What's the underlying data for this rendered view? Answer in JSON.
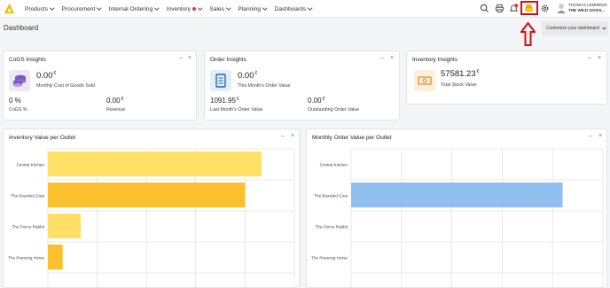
{
  "nav": {
    "items": [
      {
        "label": "Products"
      },
      {
        "label": "Procurement"
      },
      {
        "label": "Internal Ordering"
      },
      {
        "label": "Inventory"
      },
      {
        "label": "Sales"
      },
      {
        "label": "Planning"
      },
      {
        "label": "Dashboards"
      }
    ]
  },
  "user": {
    "name": "THOMAS LEMMENS",
    "company": "THE WILD GOOS..."
  },
  "notification_count": "",
  "page": {
    "title": "Dashboard",
    "customize_label": "Customize your dashboard"
  },
  "colors": {
    "accent": "#f5b800",
    "highlight": "#e30613",
    "bar_yellow": "#fbc02d",
    "bar_light_yellow": "#ffe066",
    "bar_blue": "#90bff0"
  },
  "cogs": {
    "title": "CoGS Insights",
    "value": "0.00",
    "currency": "€",
    "value_label": "Monthly Cost of Goods Sold",
    "pct": "0 %",
    "pct_label": "CoGS %",
    "revenue": "0.00",
    "revenue_currency": "€",
    "revenue_label": "Revenue"
  },
  "order": {
    "title": "Order Insights",
    "value": "0.00",
    "currency": "€",
    "value_label": "This Month's Order Value",
    "last": "1091.95",
    "last_currency": "€",
    "last_label": "Last Month's Order Value",
    "outstanding": "0.00",
    "outstanding_currency": "€",
    "outstanding_label": "Outstanding Order Value"
  },
  "inventory": {
    "title": "Inventory Insights",
    "value": "57581.23",
    "currency": "€",
    "value_label": "Total Stock Value"
  },
  "card_controls": {
    "minimize": "–",
    "close": "×"
  },
  "chart_data": [
    {
      "type": "bar",
      "orientation": "horizontal",
      "title": "Inventory Value per Outlet",
      "categories": [
        "Central Kitchen",
        "The Bearded Goat",
        "The Fierce Rabbit",
        "The Prancing Horse"
      ],
      "values": [
        26000,
        24000,
        4000,
        1800
      ],
      "colors": [
        "#ffe066",
        "#fbc02d",
        "#ffe066",
        "#fbc02d"
      ],
      "xlim": [
        0,
        30000
      ],
      "grid": true
    },
    {
      "type": "bar",
      "orientation": "horizontal",
      "title": "Monthly Order Value per Outlet",
      "categories": [
        "Central Kitchen",
        "The Bearded Goat",
        "The Fierce Rabbit",
        "The Prancing Horse"
      ],
      "values": [
        0,
        1091.95,
        0,
        0
      ],
      "colors": [
        "#90bff0",
        "#90bff0",
        "#90bff0",
        "#90bff0"
      ],
      "xlim": [
        0,
        1300
      ],
      "grid": true
    }
  ]
}
